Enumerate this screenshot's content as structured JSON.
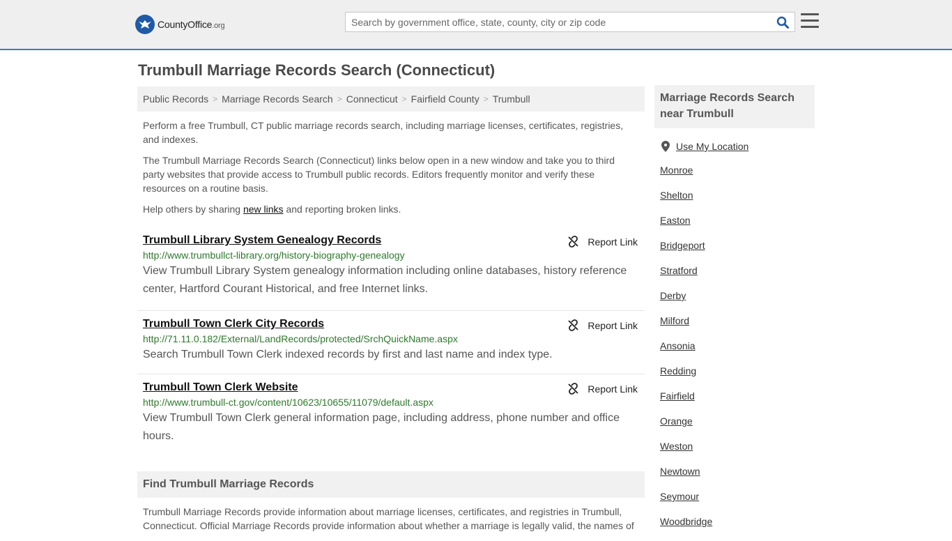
{
  "header": {
    "logo_text": "CountyOffice",
    "logo_tld": ".org",
    "search_placeholder": "Search by government office, state, county, city or zip code"
  },
  "page_title": "Trumbull Marriage Records Search (Connecticut)",
  "breadcrumb": [
    "Public Records",
    "Marriage Records Search",
    "Connecticut",
    "Fairfield County",
    "Trumbull"
  ],
  "intro": {
    "p1": "Perform a free Trumbull, CT public marriage records search, including marriage licenses, certificates, registries, and indexes.",
    "p2": "The Trumbull Marriage Records Search (Connecticut) links below open in a new window and take you to third party websites that provide access to Trumbull public records. Editors frequently monitor and verify these resources on a routine basis.",
    "p3_before": "Help others by sharing ",
    "p3_link": "new links",
    "p3_after": " and reporting broken links."
  },
  "report_label": "Report Link",
  "results": [
    {
      "title": "Trumbull Library System Genealogy Records",
      "url": "http://www.trumbullct-library.org/history-biography-genealogy",
      "desc": "View Trumbull Library System genealogy information including online databases, history reference center, Hartford Courant Historical, and free Internet links."
    },
    {
      "title": "Trumbull Town Clerk City Records",
      "url": "http://71.11.0.182/External/LandRecords/protected/SrchQuickName.aspx",
      "desc": "Search Trumbull Town Clerk indexed records by first and last name and index type."
    },
    {
      "title": "Trumbull Town Clerk Website",
      "url": "http://www.trumbull-ct.gov/content/10623/10655/11079/default.aspx",
      "desc": "View Trumbull Town Clerk general information page, including address, phone number and office hours."
    }
  ],
  "find": {
    "heading": "Find Trumbull Marriage Records",
    "text": "Trumbull Marriage Records provide information about marriage licenses, certificates, and registries in Trumbull, Connecticut. Official Marriage Records provide information about whether a marriage is legally valid, the names of"
  },
  "sidebar": {
    "heading": "Marriage Records Search near Trumbull",
    "use_location": "Use My Location",
    "cities": [
      "Monroe",
      "Shelton",
      "Easton",
      "Bridgeport",
      "Stratford",
      "Derby",
      "Milford",
      "Ansonia",
      "Redding",
      "Fairfield",
      "Orange",
      "Weston",
      "Newtown",
      "Seymour",
      "Woodbridge"
    ]
  },
  "colors": {
    "accent": "#3b7bc0",
    "logo_blue": "#1f5aa6",
    "url_green": "#2c7a2c"
  }
}
